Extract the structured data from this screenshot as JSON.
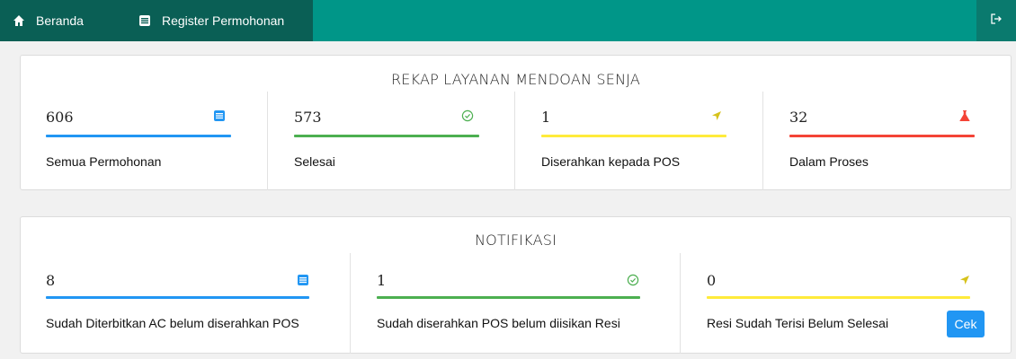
{
  "nav": {
    "home_label": "Beranda",
    "register_label": "Register Permohonan",
    "home_icon": "home-icon",
    "register_icon": "list-icon",
    "logout_icon": "logout-icon",
    "bar_color": "#009688",
    "active_color": "#0a5f55"
  },
  "rekap": {
    "title": "REKAP LAYANAN MENDOAN SENJA",
    "stats": [
      {
        "value": "606",
        "label": "Semua Permohonan",
        "icon": "list-icon",
        "color": "#2196f3"
      },
      {
        "value": "573",
        "label": "Selesai",
        "icon": "check-circle-icon",
        "color": "#4caf50"
      },
      {
        "value": "1",
        "label": "Diserahkan kepada POS",
        "icon": "send-icon",
        "color": "#ffeb3b"
      },
      {
        "value": "32",
        "label": "Dalam Proses",
        "icon": "flask-icon",
        "color": "#f44336"
      }
    ]
  },
  "notifikasi": {
    "title": "NOTIFIKASI",
    "stats": [
      {
        "value": "8",
        "label": "Sudah Diterbitkan AC belum diserahkan POS",
        "icon": "list-icon",
        "color": "#2196f3"
      },
      {
        "value": "1",
        "label": "Sudah diserahkan POS belum diisikan Resi",
        "icon": "check-circle-icon",
        "color": "#4caf50"
      },
      {
        "value": "0",
        "label": "Resi Sudah Terisi Belum Selesai",
        "icon": "send-icon",
        "color": "#ffeb3b"
      }
    ],
    "cek_label": "Cek"
  }
}
